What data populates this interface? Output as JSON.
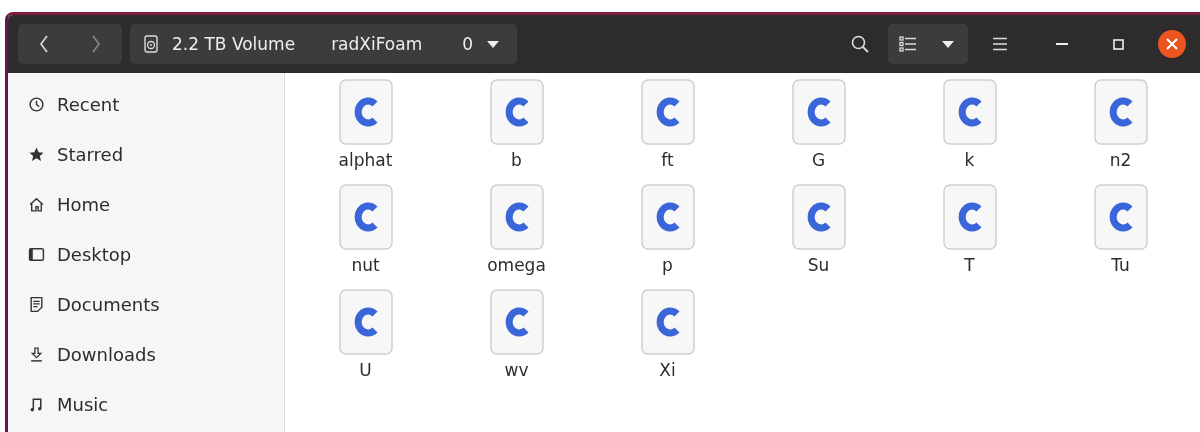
{
  "path_bar": [
    {
      "label": "2.2 TB Volume"
    },
    {
      "label": "radXiFoam"
    },
    {
      "label": "0"
    }
  ],
  "sidebar": {
    "items": [
      {
        "label": "Recent"
      },
      {
        "label": "Starred"
      },
      {
        "label": "Home"
      },
      {
        "label": "Desktop"
      },
      {
        "label": "Documents"
      },
      {
        "label": "Downloads"
      },
      {
        "label": "Music"
      }
    ]
  },
  "files": [
    {
      "name": "alphat"
    },
    {
      "name": "b"
    },
    {
      "name": "ft"
    },
    {
      "name": "G"
    },
    {
      "name": "k"
    },
    {
      "name": "n2"
    },
    {
      "name": "nut"
    },
    {
      "name": "omega"
    },
    {
      "name": "p"
    },
    {
      "name": "Su"
    },
    {
      "name": "T"
    },
    {
      "name": "Tu"
    },
    {
      "name": "U"
    },
    {
      "name": "wv"
    },
    {
      "name": "Xi"
    }
  ]
}
